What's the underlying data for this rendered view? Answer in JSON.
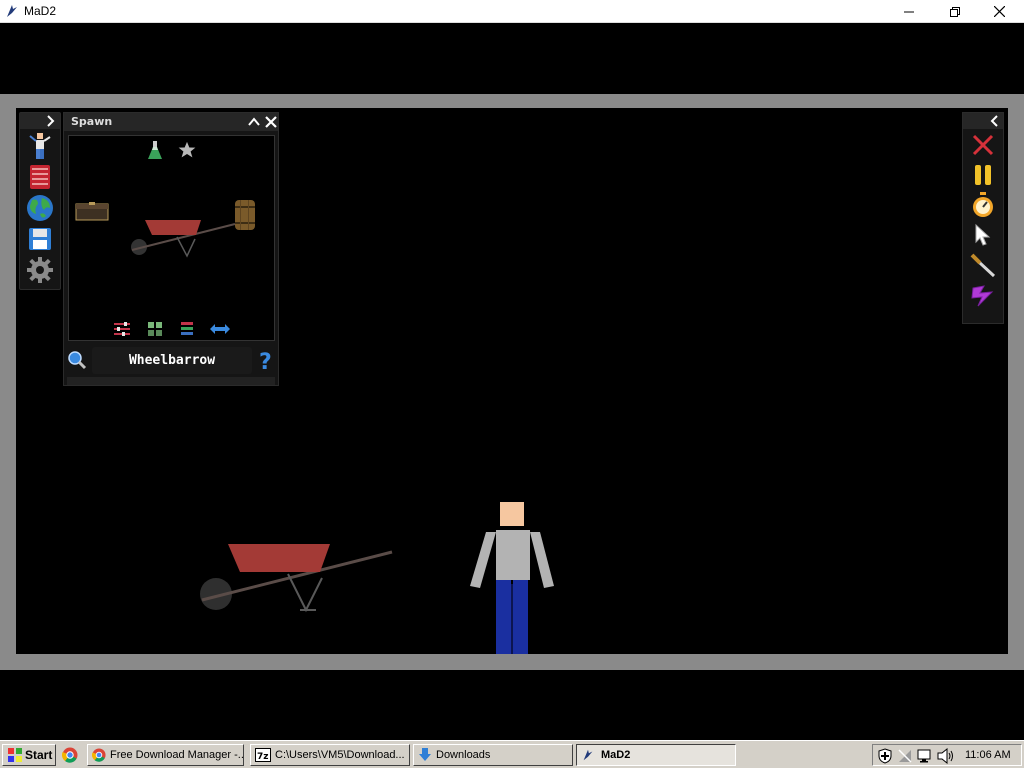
{
  "window": {
    "title": "MaD2"
  },
  "spawn_panel": {
    "title": "Spawn",
    "search_value": "Wheelbarrow"
  },
  "taskbar": {
    "start_label": "Start",
    "tasks": [
      {
        "label": "Free Download Manager -..."
      },
      {
        "label": "C:\\Users\\VM5\\Download..."
      },
      {
        "label": "Downloads"
      },
      {
        "label": "MaD2"
      }
    ],
    "clock": "11:06 AM"
  },
  "colors": {
    "wheelbarrow_tray": "#a33a36",
    "shirt": "#b3b3b3",
    "pants": "#1a2fa0",
    "skin": "#f6c7a0"
  },
  "icons": {
    "left_toolbar": [
      "person-icon",
      "book-icon",
      "globe-icon",
      "save-icon",
      "settings-gear-icon"
    ],
    "right_toolbar": [
      "clear-x-icon",
      "pause-icon",
      "stopwatch-icon",
      "cursor-icon",
      "knife-icon",
      "lightning-icon"
    ],
    "spawn_filters": [
      "flask-icon",
      "star-icon"
    ],
    "spawn_bottom": [
      "sliders-icon",
      "grid-icon",
      "list-icon",
      "swap-arrows-icon"
    ]
  }
}
